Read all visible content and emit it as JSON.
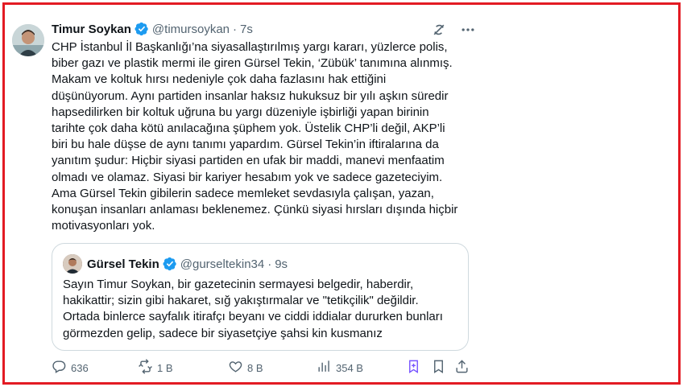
{
  "tweet": {
    "author_name": "Timur Soykan",
    "handle": "@timursoykan",
    "separator": "·",
    "time": "7s",
    "text": "CHP İstanbul İl Başkanlığı’na siyasallaştırılmış yargı kararı, yüzlerce polis,\nbiber gazı ve plastik mermi ile giren Gürsel Tekin, ‘Zübük’ tanımına alınmış.\nMakam ve koltuk hırsı nedeniyle çok daha fazlasını hak ettiğini\ndüşünüyorum. Aynı partiden insanlar haksız hukuksuz bir yılı aşkın süredir\nhapsedilirken bir koltuk uğruna bu yargı düzeniyle işbirliği yapan birinin\ntarihte çok daha kötü anılacağına şüphem yok. Üstelik CHP’li değil, AKP’li\nbiri bu hale düşse de aynı tanımı yapardım. Gürsel Tekin’in iftiralarına da\nyanıtım şudur: Hiçbir siyasi partiden en ufak bir maddi, manevi menfaatim\nolmadı ve olamaz. Siyasi bir kariyer hesabım yok ve sadece gazeteciyim.\nAma Gürsel Tekin gibilerin sadece memleket sevdasıyla çalışan, yazan,\nkonuşan insanları anlaması beklenemez. Çünkü siyasi hırsları dışında hiçbir\nmotivasyonları yok."
  },
  "quote": {
    "author_name": "Gürsel Tekin",
    "handle": "@gurseltekin34",
    "separator": "·",
    "time": "9s",
    "text": "Sayın Timur Soykan, bir gazetecinin sermayesi belgedir, haberdir,\nhakikattir; sizin gibi hakaret, sığ yakıştırmalar ve \"tetikçilik\" değildir.\nOrtada binlerce sayfalık itirafçı beyanı ve ciddi iddialar dururken bunları\ngörmezden gelip, sadece bir siyasetçiye şahsi kin kusmanız"
  },
  "actions": {
    "replies": "636",
    "reposts": "1 B",
    "likes": "8 B",
    "views": "354 B"
  },
  "icons": {
    "top": [
      "grok-icon",
      "more-icon"
    ],
    "actions": [
      "reply-icon",
      "retweet-icon",
      "like-icon",
      "views-icon",
      "bookmark-icon",
      "share-icon"
    ]
  },
  "colors": {
    "frame": "#e31b23",
    "verified": "#1d9bf0",
    "bookmarked": "#7856ff",
    "muted": "#536471",
    "text": "#0f1419",
    "border": "#cfd9de"
  }
}
